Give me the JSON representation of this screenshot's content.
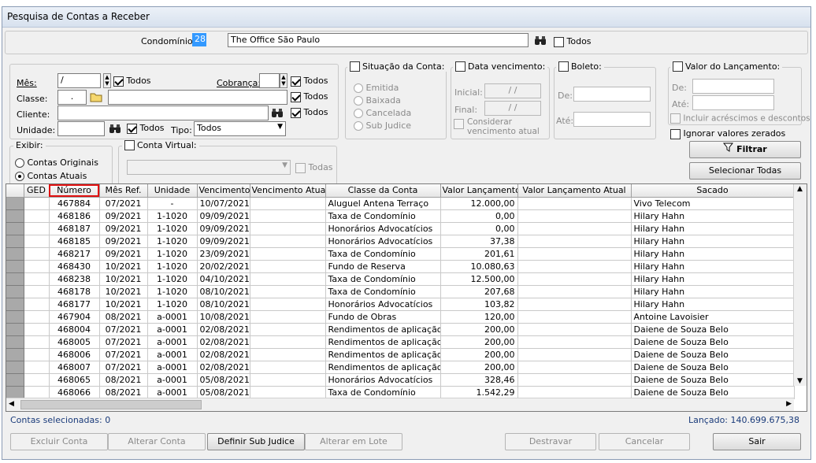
{
  "window": {
    "title": "Pesquisa de Contas a Receber"
  },
  "condominio": {
    "label": "Condomínio:",
    "code": "28",
    "name": "The Office São Paulo",
    "todos_label": "Todos"
  },
  "filters": {
    "mes_label": "Mês:",
    "mes_value": "/",
    "mes_todos": "Todos",
    "cobranca_label": "Cobrança:",
    "cobranca_todos": "Todos",
    "classe_label": "Classe:",
    "classe_value": ".",
    "classe_todos": "Todos",
    "cliente_label": "Cliente:",
    "cliente_todos": "Todos",
    "unidade_label": "Unidade:",
    "unidade_todos": "Todos",
    "tipo_label": "Tipo:",
    "tipo_value": "Todos"
  },
  "situacao": {
    "title": "Situação da Conta:",
    "options": [
      "Emitida",
      "Baixada",
      "Cancelada",
      "Sub Judice"
    ]
  },
  "data_vencimento": {
    "title": "Data vencimento:",
    "inicial_label": "Inicial:",
    "inicial_value": "/ /",
    "final_label": "Final:",
    "final_value": "/ /",
    "considerar_label": "Considerar vencimento atual"
  },
  "boleto": {
    "title": "Boleto:",
    "de_label": "De:",
    "ate_label": "Até:"
  },
  "valor_lancamento": {
    "title": "Valor do Lançamento:",
    "de_label": "De:",
    "ate_label": "Até:",
    "incluir_label": "Incluir acréscimos e descontos",
    "ignorar_label": "Ignorar valores zerados"
  },
  "exibir": {
    "title": "Exibir:",
    "options": [
      "Contas Originais",
      "Contas Atuais"
    ]
  },
  "conta_virtual": {
    "title": "Conta Virtual:",
    "todas_label": "Todas"
  },
  "buttons": {
    "filtrar": "Filtrar",
    "selecionar_todas": "Selecionar Todas",
    "excluir_conta": "Excluir Conta",
    "alterar_conta": "Alterar Conta",
    "definir_sub_judice": "Definir Sub Judice",
    "alterar_em_lote": "Alterar em Lote",
    "destravar": "Destravar",
    "cancelar": "Cancelar",
    "sair": "Sair"
  },
  "grid": {
    "columns": [
      "GED",
      "Número",
      "Mês Ref.",
      "Unidade",
      "Vencimento",
      "Vencimento Atual",
      "Classe da Conta",
      "Valor Lançamento",
      "Valor Lançamento Atual",
      "Sacado"
    ],
    "rows": [
      [
        "",
        "467884",
        "07/2021",
        "-",
        "10/07/2021",
        "",
        "Aluguel Antena Terraço",
        "12.000,00",
        "",
        "Vivo Telecom"
      ],
      [
        "",
        "468186",
        "09/2021",
        "1-1020",
        "09/09/2021",
        "",
        "Taxa de Condomínio",
        "0,00",
        "",
        "Hilary Hahn"
      ],
      [
        "",
        "468187",
        "09/2021",
        "1-1020",
        "09/09/2021",
        "",
        "Honorários Advocatícios",
        "0,00",
        "",
        "Hilary Hahn"
      ],
      [
        "",
        "468185",
        "09/2021",
        "1-1020",
        "09/09/2021",
        "",
        "Honorários Advocatícios",
        "37,38",
        "",
        "Hilary Hahn"
      ],
      [
        "",
        "468217",
        "09/2021",
        "1-1020",
        "23/09/2021",
        "",
        "Taxa de Condomínio",
        "201,61",
        "",
        "Hilary Hahn"
      ],
      [
        "",
        "468430",
        "10/2021",
        "1-1020",
        "20/02/2021",
        "",
        "Fundo de Reserva",
        "10.080,63",
        "",
        "Hilary Hahn"
      ],
      [
        "",
        "468238",
        "10/2021",
        "1-1020",
        "04/10/2021",
        "",
        "Taxa de Condomínio",
        "12.500,00",
        "",
        "Hilary Hahn"
      ],
      [
        "",
        "468178",
        "10/2021",
        "1-1020",
        "08/10/2021",
        "",
        "Taxa de Condomínio",
        "207,68",
        "",
        "Hilary Hahn"
      ],
      [
        "",
        "468177",
        "10/2021",
        "1-1020",
        "08/10/2021",
        "",
        "Honorários Advocatícios",
        "103,82",
        "",
        "Hilary Hahn"
      ],
      [
        "",
        "467904",
        "08/2021",
        "a-0001",
        "10/08/2021",
        "",
        "Fundo de Obras",
        "120,00",
        "",
        "Antoine Lavoisier"
      ],
      [
        "",
        "468004",
        "07/2021",
        "a-0001",
        "02/08/2021",
        "",
        "Rendimentos de aplicação",
        "200,00",
        "",
        "Daiene de Souza Belo"
      ],
      [
        "",
        "468005",
        "07/2021",
        "a-0001",
        "02/08/2021",
        "",
        "Rendimentos de aplicação",
        "200,00",
        "",
        "Daiene de Souza Belo"
      ],
      [
        "",
        "468006",
        "07/2021",
        "a-0001",
        "02/08/2021",
        "",
        "Rendimentos de aplicação",
        "200,00",
        "",
        "Daiene de Souza Belo"
      ],
      [
        "",
        "468007",
        "07/2021",
        "a-0001",
        "02/08/2021",
        "",
        "Rendimentos de aplicação",
        "200,00",
        "",
        "Daiene de Souza Belo"
      ],
      [
        "",
        "468065",
        "08/2021",
        "a-0001",
        "05/08/2021",
        "",
        "Honorários Advocatícios",
        "328,46",
        "",
        "Daiene de Souza Belo"
      ],
      [
        "",
        "468066",
        "08/2021",
        "a-0001",
        "05/08/2021",
        "",
        "Taxa de Condomínio",
        "1.542,29",
        "",
        "Daiene de Souza Belo"
      ]
    ]
  },
  "status": {
    "selecionadas": "Contas selecionadas: 0",
    "lancado": "Lançado: 140.699.675,38"
  },
  "colors": {
    "highlight": "#e01010",
    "status_text": "#1a3b7a"
  }
}
